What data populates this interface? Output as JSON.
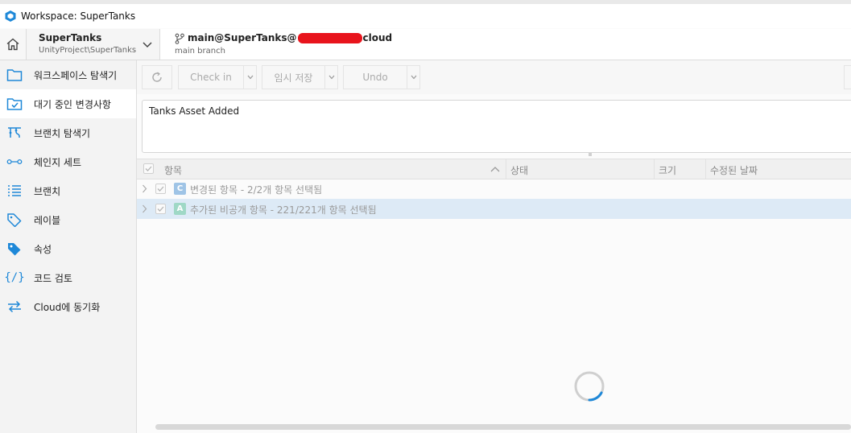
{
  "window": {
    "title": "Workspace: SuperTanks"
  },
  "workspace": {
    "name": "SuperTanks",
    "path": "UnityProject\\SuperTanks",
    "branch_prefix": "main@SuperTanks@",
    "branch_suffix": "cloud",
    "branch_sub": "main branch"
  },
  "sidebar": {
    "items": [
      {
        "label": "워크스페이스 탐색기",
        "icon": "folder-icon",
        "active": false
      },
      {
        "label": "대기 중인 변경사항",
        "icon": "pending-changes-icon",
        "active": true
      },
      {
        "label": "브랜치 탐색기",
        "icon": "branch-explorer-icon",
        "active": false
      },
      {
        "label": "체인지 세트",
        "icon": "changeset-icon",
        "active": false
      },
      {
        "label": "브랜치",
        "icon": "list-icon",
        "active": false
      },
      {
        "label": "레이블",
        "icon": "tag-icon",
        "active": false
      },
      {
        "label": "속성",
        "icon": "attributes-icon",
        "active": false
      },
      {
        "label": "코드 검토",
        "icon": "code-review-icon",
        "active": false
      },
      {
        "label": "Cloud에 동기화",
        "icon": "sync-icon",
        "active": false
      }
    ]
  },
  "toolbar": {
    "checkin_label": "Check in",
    "shelve_label": "임시 저장",
    "undo_label": "Undo"
  },
  "comment": {
    "value": "Tanks Asset Added"
  },
  "table": {
    "columns": [
      "항목",
      "상태",
      "크기",
      "수정된 날짜"
    ],
    "rows": [
      {
        "badge": "C",
        "badge_color": "#9fc4e6",
        "text": "변경된 항목 - 2/2개 항목 선택됨",
        "selected": false
      },
      {
        "badge": "A",
        "badge_color": "#9fd8c6",
        "text": "추가된 비공개 항목 - 221/221개 항목 선택됨",
        "selected": true
      }
    ]
  },
  "colors": {
    "accent": "#1e88d8",
    "selected_row": "#ddeaf6"
  }
}
